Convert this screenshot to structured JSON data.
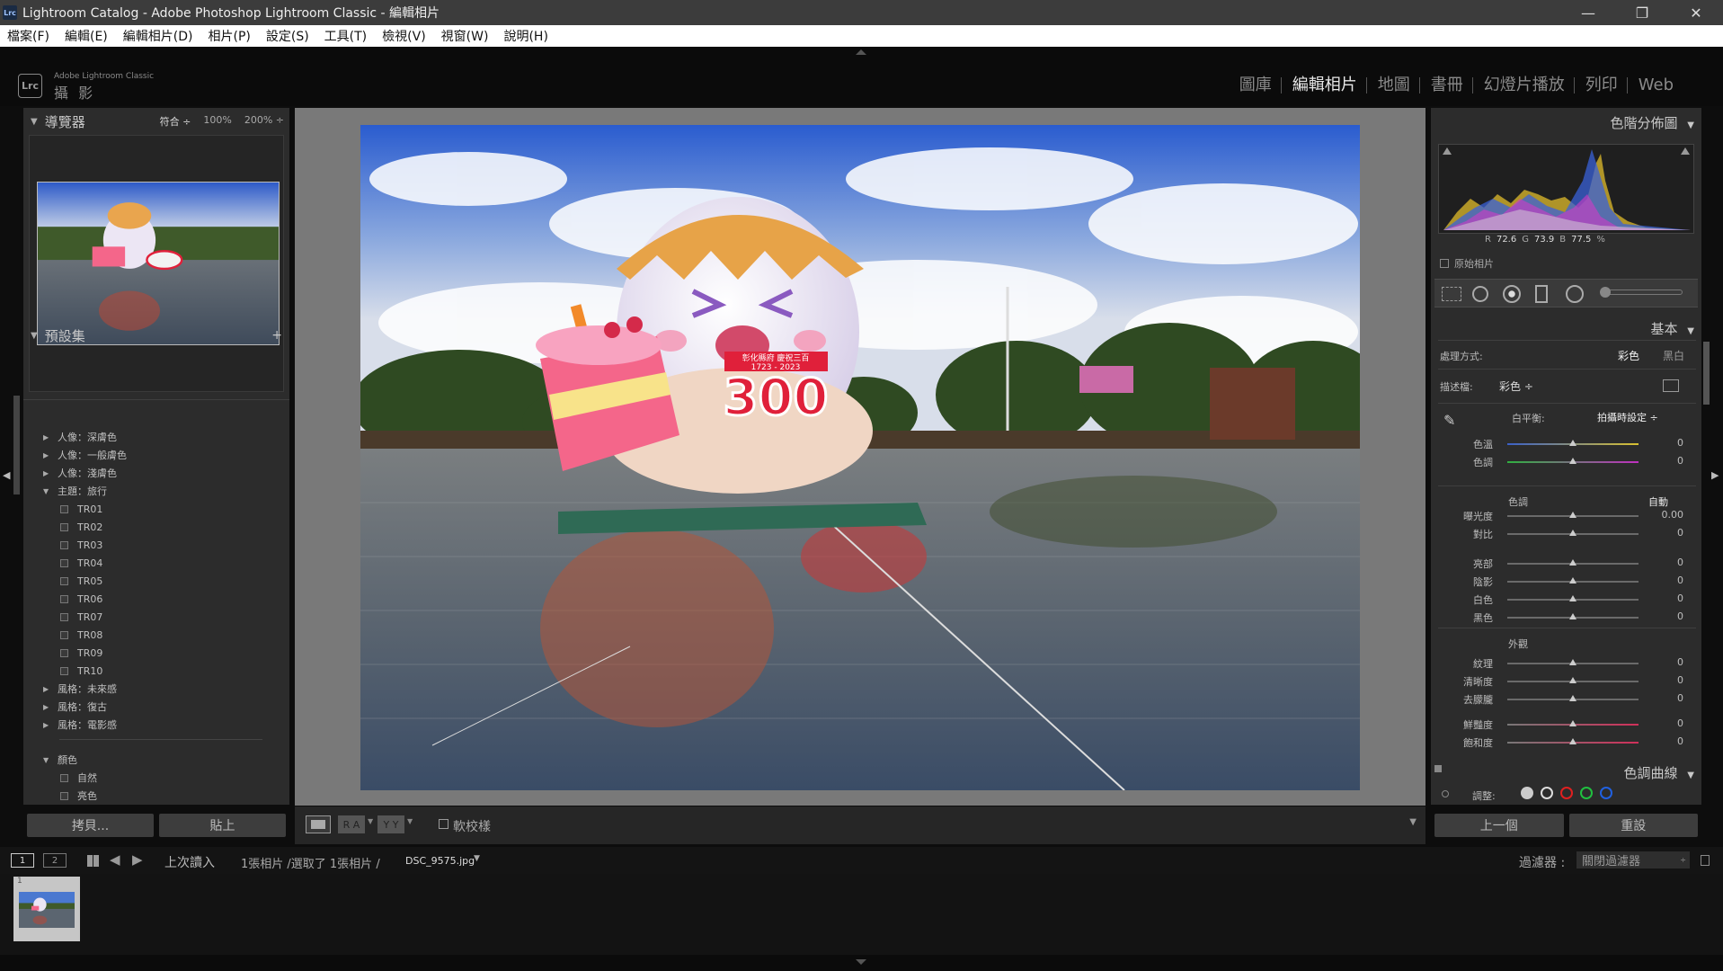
{
  "window": {
    "title": "Lightroom Catalog - Adobe Photoshop Lightroom Classic - 編輯相片",
    "badge": "Lrc",
    "minimize": "—",
    "restore": "❐",
    "close": "✕"
  },
  "menu": [
    "檔案(F)",
    "編輯(E)",
    "編輯相片(D)",
    "相片(P)",
    "設定(S)",
    "工具(T)",
    "檢視(V)",
    "視窗(W)",
    "說明(H)"
  ],
  "identity": {
    "logo": "Lrc",
    "product": "Adobe Lightroom Classic",
    "user": "攝 影"
  },
  "modules": [
    {
      "label": "圖庫",
      "active": false
    },
    {
      "label": "編輯相片",
      "active": true
    },
    {
      "label": "地圖",
      "active": false
    },
    {
      "label": "書冊",
      "active": false
    },
    {
      "label": "幻燈片播放",
      "active": false
    },
    {
      "label": "列印",
      "active": false
    },
    {
      "label": "Web",
      "active": false
    }
  ],
  "navigator": {
    "title": "導覽器",
    "fit": "符合 ÷",
    "z100": "100%",
    "z200": "200% ÷"
  },
  "presets": {
    "title": "預設集",
    "add": "+",
    "items": [
      {
        "label": "人像：深膚色",
        "type": "collapsed"
      },
      {
        "label": "人像：一般膚色",
        "type": "collapsed"
      },
      {
        "label": "人像：淺膚色",
        "type": "collapsed"
      },
      {
        "label": "主題：旅行",
        "type": "expanded"
      },
      {
        "label": "TR01",
        "type": "preset"
      },
      {
        "label": "TR02",
        "type": "preset"
      },
      {
        "label": "TR03",
        "type": "preset"
      },
      {
        "label": "TR04",
        "type": "preset"
      },
      {
        "label": "TR05",
        "type": "preset"
      },
      {
        "label": "TR06",
        "type": "preset"
      },
      {
        "label": "TR07",
        "type": "preset"
      },
      {
        "label": "TR08",
        "type": "preset"
      },
      {
        "label": "TR09",
        "type": "preset"
      },
      {
        "label": "TR10",
        "type": "preset"
      },
      {
        "label": "風格：未來感",
        "type": "collapsed"
      },
      {
        "label": "風格：復古",
        "type": "collapsed"
      },
      {
        "label": "風格：電影感",
        "type": "collapsed"
      }
    ],
    "colors_group": "顏色",
    "color_items": [
      "自然",
      "亮色"
    ]
  },
  "left_buttons": {
    "copy": "拷貝...",
    "paste": "貼上"
  },
  "histogram": {
    "title": "色階分佈圖",
    "r_label": "R",
    "r": "72.6",
    "g_label": "G",
    "g": "73.9",
    "b_label": "B",
    "b": "77.5",
    "pct": "%",
    "original": "原始相片"
  },
  "basic": {
    "title": "基本",
    "treatment_label": "處理方式:",
    "color": "彩色",
    "bw": "黑白",
    "profile_label": "描述檔:",
    "profile_value": "彩色 ÷",
    "wb_label": "白平衡:",
    "wb_value": "拍攝時設定 ÷",
    "tone_label": "色調",
    "auto": "自動",
    "presence_label": "外觀"
  },
  "sliders": [
    {
      "label": "色溫",
      "value": "0",
      "level": 0.5
    },
    {
      "label": "色調",
      "value": "0",
      "level": 0.5
    },
    {
      "label": "曝光度",
      "value": "0.00",
      "level": 0.5
    },
    {
      "label": "對比",
      "value": "0",
      "level": 0.5
    },
    {
      "label": "亮部",
      "value": "0",
      "level": 0.5
    },
    {
      "label": "陰影",
      "value": "0",
      "level": 0.5
    },
    {
      "label": "白色",
      "value": "0",
      "level": 0.5
    },
    {
      "label": "黑色",
      "value": "0",
      "level": 0.5
    },
    {
      "label": "紋理",
      "value": "0",
      "level": 0.5
    },
    {
      "label": "清晰度",
      "value": "0",
      "level": 0.5
    },
    {
      "label": "去朦朧",
      "value": "0",
      "level": 0.5
    },
    {
      "label": "鮮豔度",
      "value": "0",
      "level": 0.5
    },
    {
      "label": "飽和度",
      "value": "0",
      "level": 0.5
    }
  ],
  "tone_curve": {
    "title": "色調曲線",
    "adjust_label": "調整:"
  },
  "right_buttons": {
    "previous": "上一個",
    "reset": "重設"
  },
  "toolbar": {
    "ra": "R A",
    "yy": "Y Y",
    "soft_proof": "軟校樣"
  },
  "photo_sign": {
    "line1": "彰化縣府 慶祝三百",
    "line2": "1723 - 2023",
    "big": "300"
  },
  "filmstrip": {
    "view1": "1",
    "view2": "2",
    "source": "上次讀入",
    "count": "1張相片 /選取了 1張相片 /",
    "filename": "DSC_9575.jpg",
    "filter_label": "過濾器 :",
    "filter_value": "關閉過濾器",
    "thumb_index": "1"
  },
  "colors": {
    "accent": "#e6e6e6",
    "panel": "#2c2c2c",
    "center": "#797979"
  }
}
